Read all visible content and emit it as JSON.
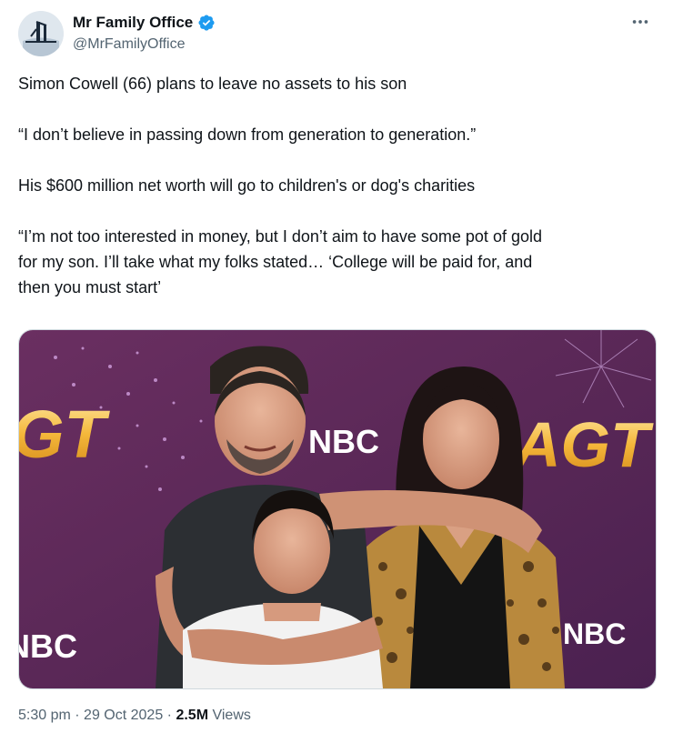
{
  "tweet": {
    "author": {
      "display_name": "Mr Family Office",
      "handle": "@MrFamilyOffice",
      "verified": true
    },
    "text": {
      "p1": "Simon Cowell (66) plans to leave no assets to his son",
      "p2": " “I don’t believe in passing down from generation to generation.”",
      "p3": "His $600 million net worth will go to children's or dog's charities",
      "p4_line1": "“I’m not too interested in money, but I don’t aim to have some pot of gold",
      "p4_line2": "for my son. I’ll take what my folks stated… ‘College will be paid for, and",
      "p4_line3": "then you must start’"
    },
    "media": {
      "backdrop_logos": {
        "agt_left": "GT",
        "agt_right": "AGT",
        "nbc_center": "NBC",
        "nbc_left": "NBC",
        "nbc_right": "NBC"
      }
    },
    "meta": {
      "time": "5:30 pm",
      "separator": "·",
      "date": "29 Oct 2025",
      "views_count": "2.5M",
      "views_label": "Views"
    }
  },
  "colors": {
    "verified_blue": "#1d9bf0",
    "backdrop_purple": "#5c2a56",
    "text_primary": "#0f1419",
    "text_secondary": "#536471"
  },
  "icons": {
    "verified": "verified-badge-icon",
    "more": "more-dots-icon"
  }
}
